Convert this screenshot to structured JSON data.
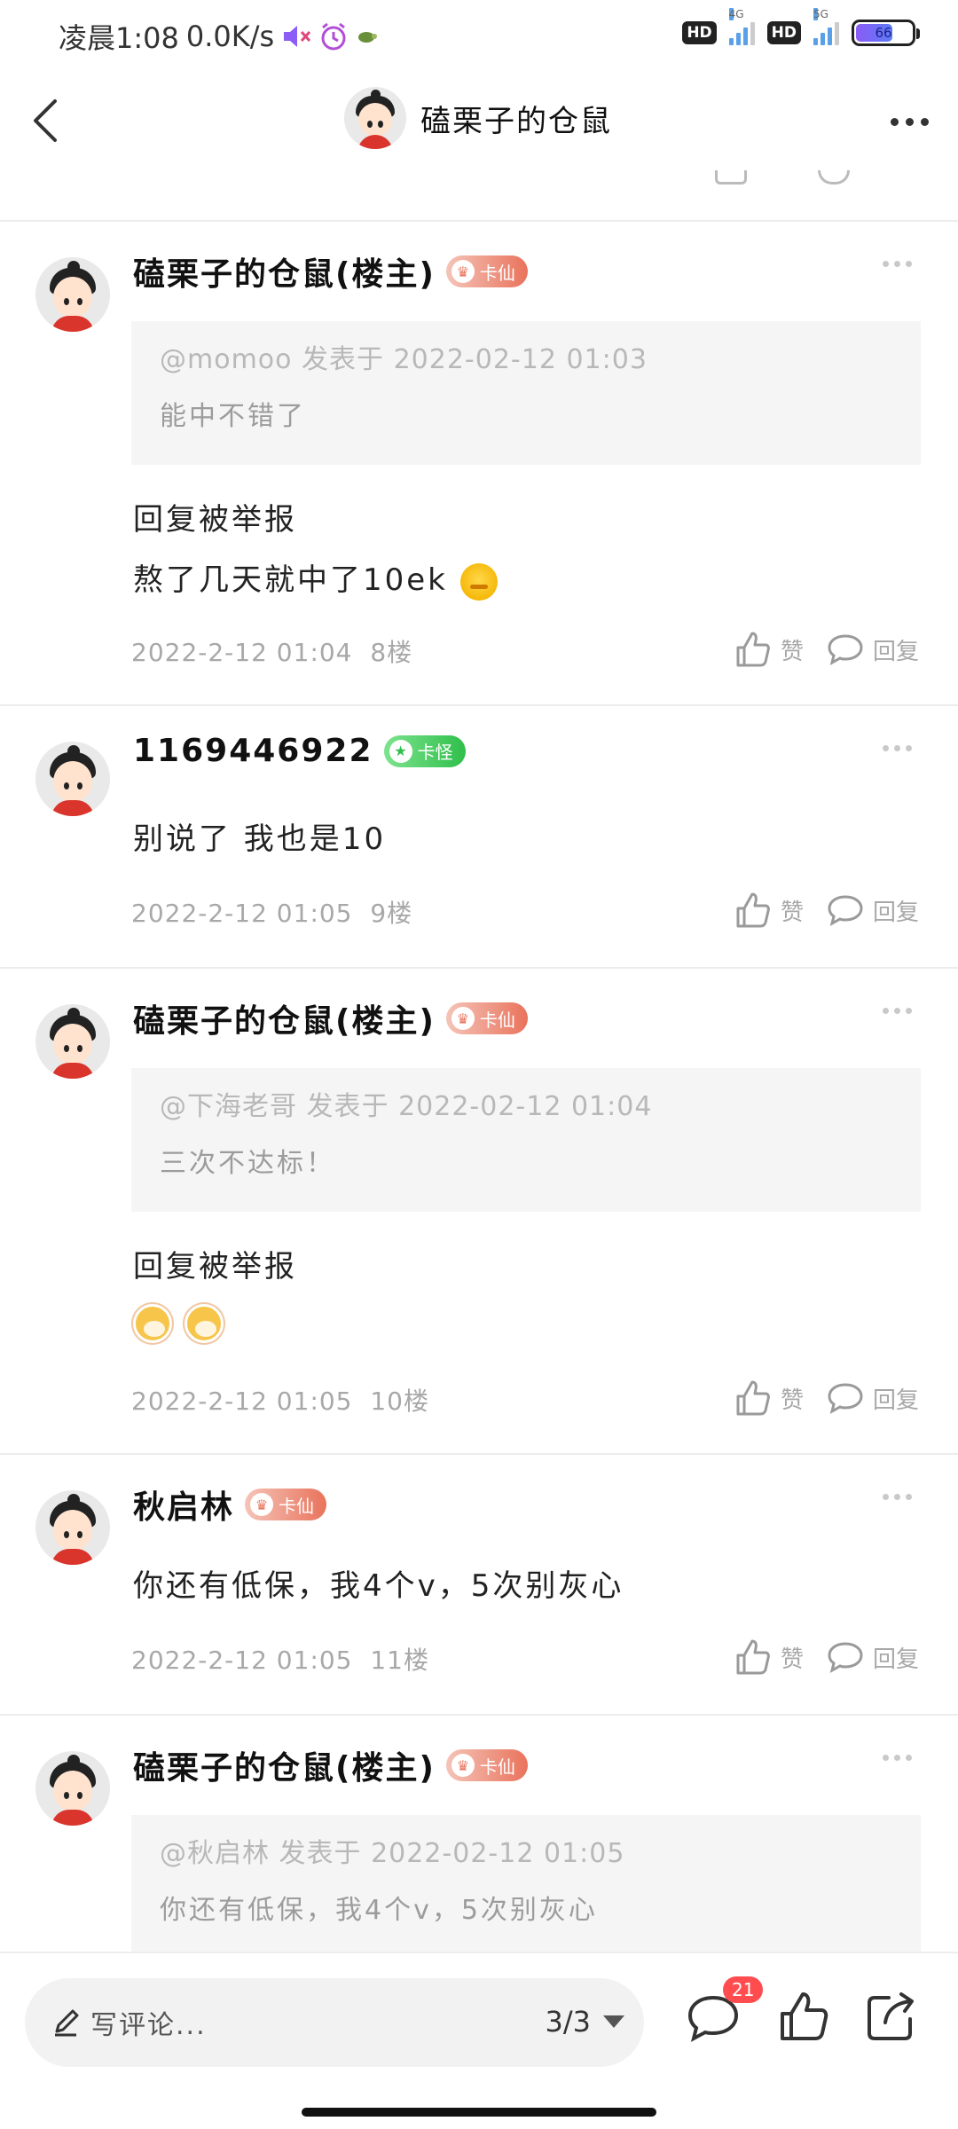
{
  "status_bar": {
    "time_text": "凌晨1:08",
    "speed_text": "0.0K/s",
    "hd_label": "HD",
    "net_4g": "4G",
    "net_5g": "5G",
    "battery_level": "66"
  },
  "header": {
    "title": "磕栗子的仓鼠"
  },
  "comments": [
    {
      "name": "磕栗子的仓鼠(楼主)",
      "badge": "卡仙",
      "quote_meta": "@momoo 发表于 2022-02-12 01:03",
      "quote_text": "能中不错了",
      "lines": [
        "回复被举报",
        "熬了几天就中了10ek"
      ],
      "date": "2022-2-12 01:04",
      "floor": "8楼"
    },
    {
      "name": "1169446922",
      "badge": "卡怪",
      "lines": [
        "别说了 我也是10"
      ],
      "date": "2022-2-12 01:05",
      "floor": "9楼"
    },
    {
      "name": "磕栗子的仓鼠(楼主)",
      "badge": "卡仙",
      "quote_meta": "@下海老哥 发表于 2022-02-12 01:04",
      "quote_text": "三次不达标！",
      "lines": [
        "回复被举报"
      ],
      "date": "2022-2-12 01:05",
      "floor": "10楼"
    },
    {
      "name": "秋启林",
      "badge": "卡仙",
      "lines": [
        "你还有低保，我4个v，5次别灰心"
      ],
      "date": "2022-2-12 01:05",
      "floor": "11楼"
    },
    {
      "name": "磕栗子的仓鼠(楼主)",
      "badge": "卡仙",
      "quote_meta": "@秋启林 发表于 2022-02-12 01:05",
      "quote_text": "你还有低保，我4个v，5次别灰心"
    }
  ],
  "actions": {
    "like_label": "赞",
    "reply_label": "回复"
  },
  "bottom_bar": {
    "input_placeholder": "写评论...",
    "page_indicator": "3/3",
    "comment_count": "21"
  },
  "colors": {
    "badge_xian": "#e9735c",
    "badge_guai": "#2fbf4a",
    "count_badge": "#ff4d4f"
  }
}
